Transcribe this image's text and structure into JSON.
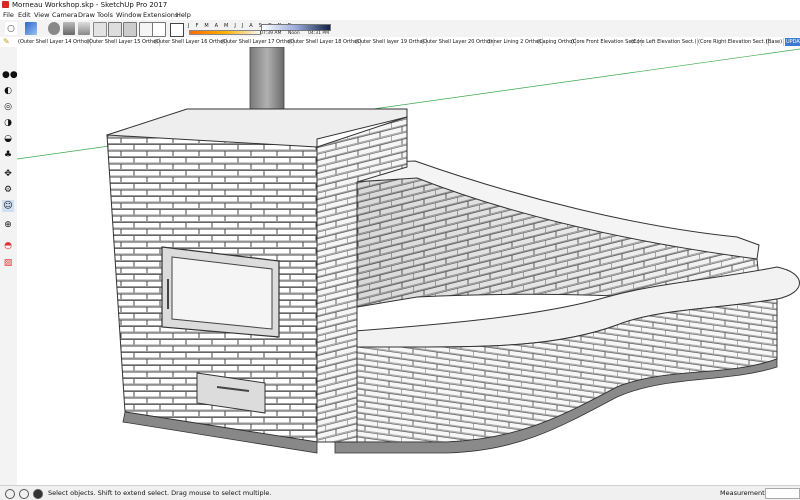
{
  "window": {
    "title": "Morneau Workshop.skp - SketchUp Pro 2017"
  },
  "menu": [
    "File",
    "Edit",
    "View",
    "Camera",
    "Draw",
    "Tools",
    "Window",
    "Extensions",
    "Help"
  ],
  "shadow": {
    "months": "J F M A M J J A S O N D",
    "time_start": "07:39 AM",
    "noon": "Noon",
    "time_end": "04:31 PM"
  },
  "scenes": [
    "(Outer Shell Layer 14 Ortho)",
    "(Outer Shell Layer 15 Ortho)",
    "(Outer Shell Layer 16 Ortho)",
    "(Outer Shell Layer 17 Ortho)",
    "(Outer Shell Layer 18 Ortho)",
    "(Outer Shell layer 19 Ortho)",
    "(Outer Shell Layer 20 Ortho)",
    "(Inner Lining 2 Ortho)",
    "(Caping Ortho)",
    "(Core Front Elevation Sect.)",
    "(Core Left Elevation Sect.)",
    "(Core Right Elevation Sect.)",
    "(Base)",
    "UPDATE"
  ],
  "status": {
    "message": "Select objects. Shift to extend select. Drag mouse to select multiple.",
    "measurements_label": "Measurements",
    "measurements_value": ""
  },
  "colors": {
    "accent": "#3a7bd5",
    "axis_green": "#3aa84a",
    "brick_white": "#ffffff",
    "mortar": "#4a4a4a"
  }
}
